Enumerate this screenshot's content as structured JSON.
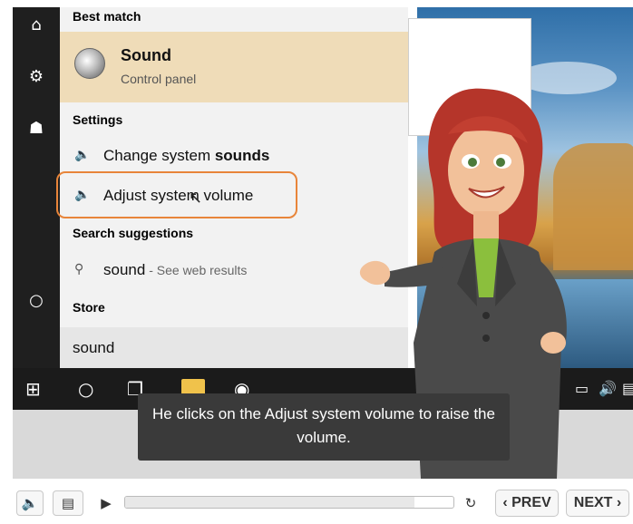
{
  "start_menu": {
    "best_match_heading": "Best match",
    "best_match": {
      "title": "Sound",
      "subtitle": "Control panel",
      "icon": "speaker-icon"
    },
    "settings_heading": "Settings",
    "settings_items": [
      {
        "pre": "Change system ",
        "bold": "sounds",
        "post": "",
        "icon": "speaker-small-icon"
      },
      {
        "pre": "Adjust system volume",
        "bold": "",
        "post": "",
        "icon": "speaker-small-icon"
      }
    ],
    "suggestions_heading": "Search suggestions",
    "suggestion": {
      "text": "sound",
      "sub": " - See web results",
      "icon": "search-icon"
    },
    "store_heading": "Store",
    "search_value": "sound"
  },
  "left_rail": [
    "home-icon",
    "gear-icon",
    "user-icon",
    "power-icon"
  ],
  "taskbar": {
    "icons": [
      "windows-start-icon",
      "cortana-circle-icon",
      "task-view-icon",
      "folder-icon",
      "speaker-icon",
      "network-icon",
      "volume-icon",
      "notification-icon"
    ]
  },
  "caption": {
    "text": "He clicks on the Adjust system volume to raise the volume."
  },
  "player": {
    "volume_icon": "volume-icon",
    "captions_icon": "captions-icon",
    "play_icon": "play-icon",
    "replay_icon": "replay-icon",
    "progress": 0.88,
    "prev_label": "PREV",
    "next_label": "NEXT"
  }
}
